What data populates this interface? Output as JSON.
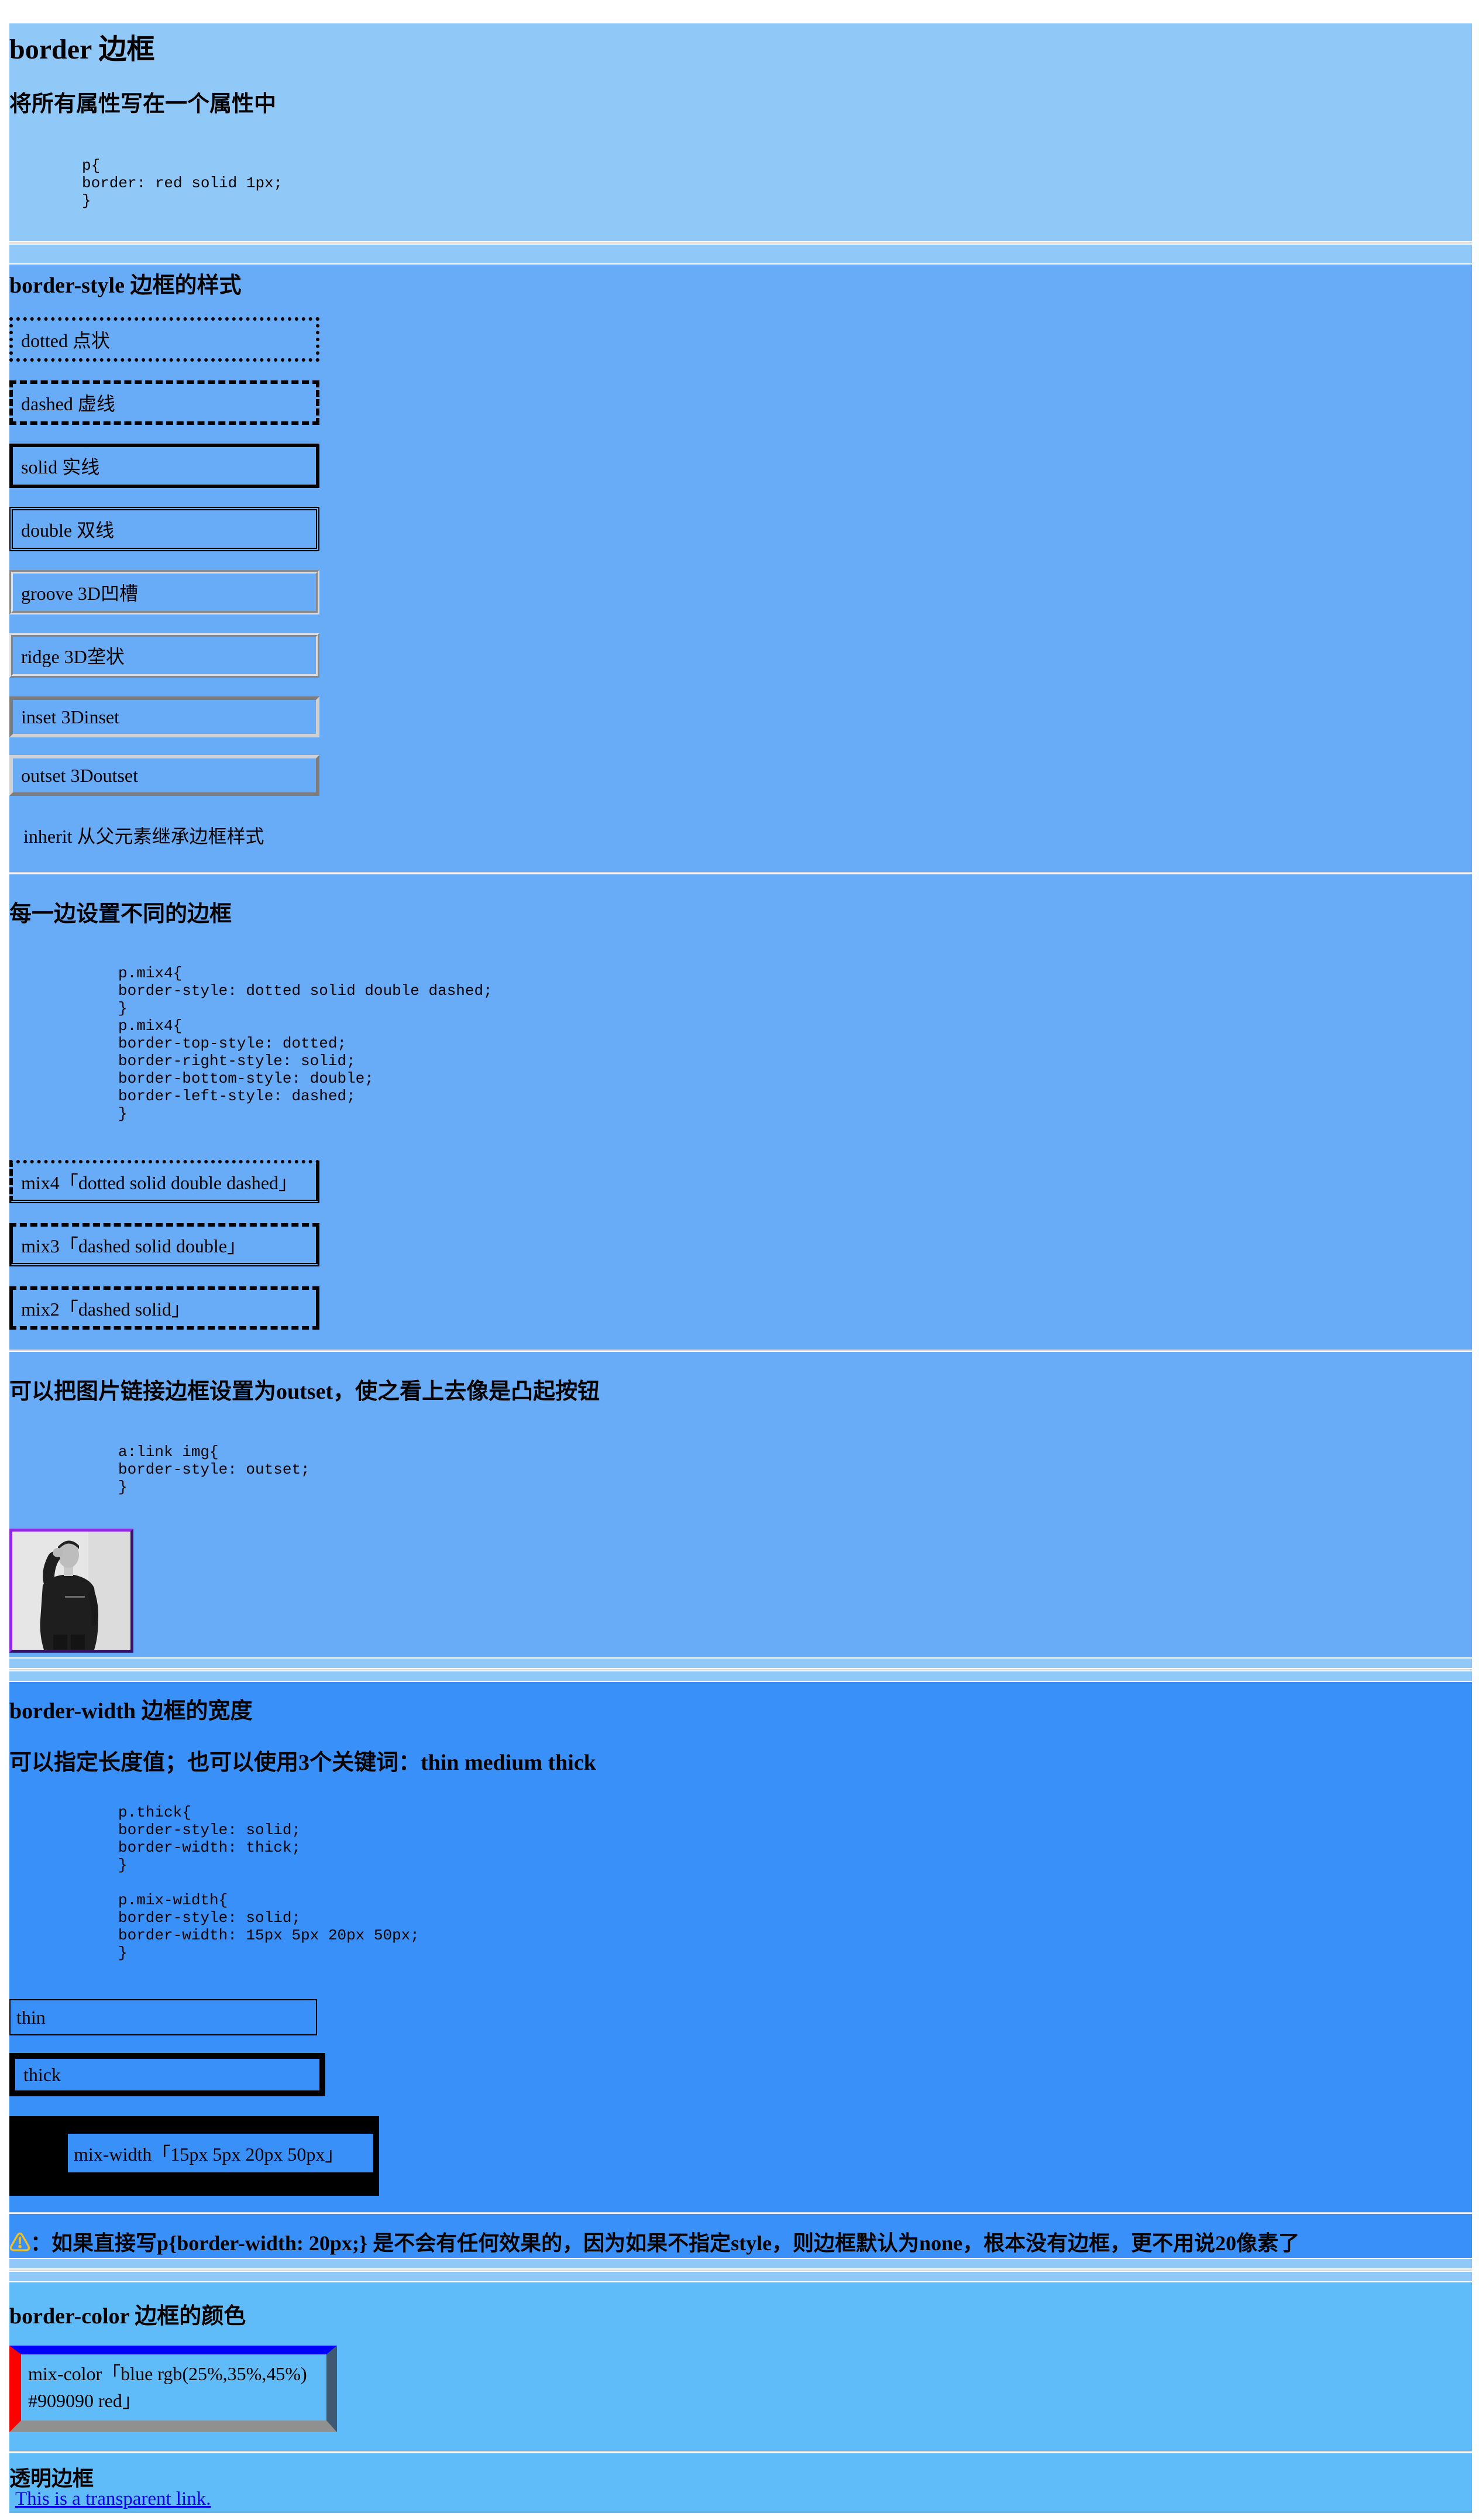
{
  "section1": {
    "title": "border 边框",
    "subtitle": "将所有属性写在一个属性中",
    "code": "p{\nborder: red solid 1px;\n}"
  },
  "section2": {
    "title": "border-style 边框的样式",
    "styles": [
      "dotted 点状",
      "dashed 虚线",
      "solid 实线",
      "double 双线",
      "groove 3D凹槽",
      "ridge 3D垄状",
      "inset 3Dinset",
      "outset 3Doutset",
      "inherit 从父元素继承边框样式"
    ],
    "each_side_heading": "每一边设置不同的边框",
    "each_side_code": "p.mix4{\nborder-style: dotted solid double dashed;\n}\np.mix4{\nborder-top-style: dotted;\nborder-right-style: solid;\nborder-bottom-style: double;\nborder-left-style: dashed;\n}",
    "mix_boxes": [
      "mix4「dotted solid double dashed」",
      "mix3「dashed solid double」",
      "mix2「dashed solid」"
    ],
    "image_link_heading": "可以把图片链接边框设置为outset，使之看上去像是凸起按钮",
    "image_link_code": "a:link img{\nborder-style: outset;\n}"
  },
  "section3": {
    "title": "border-width 边框的宽度",
    "subtitle": "可以指定长度值；也可以使用3个关键词：thin medium thick",
    "code": "p.thick{\nborder-style: solid;\nborder-width: thick;\n}\n\np.mix-width{\nborder-style: solid;\nborder-width: 15px 5px 20px 50px;\n}",
    "boxes": [
      "thin",
      "thick",
      "mix-width「15px 5px 20px 50px」"
    ],
    "warning_symbol": "⚠",
    "warning_text": "：如果直接写p{border-width: 20px;} 是不会有任何效果的，因为如果不指定style，则边框默认为none，根本没有边框，更不用说20像素了"
  },
  "section4": {
    "title": "border-color 边框的颜色",
    "box_line1": "mix-color「blue rgb(25%,35%,45%)",
    "box_line2": "#909090 red」",
    "transparent_heading": "透明边框",
    "transparent_link": "This is a transparent link."
  },
  "colors": {
    "section1_bg": "#90c8f8",
    "section2_bg": "#68acf8",
    "section3_bg": "#3890f8",
    "section4_bg": "#60bcf8",
    "link": "#0000ee"
  }
}
